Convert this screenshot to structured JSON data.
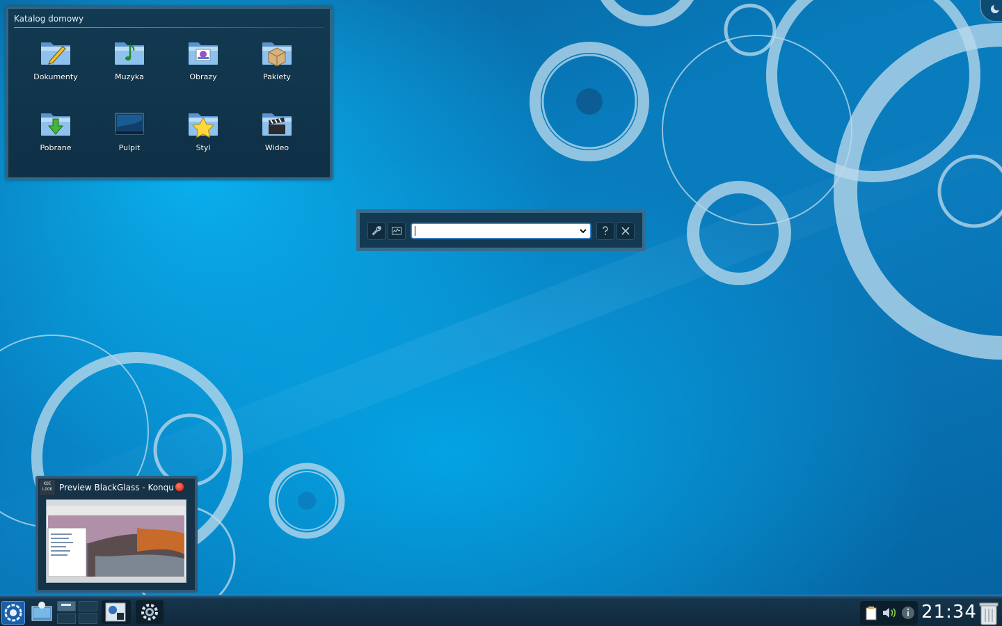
{
  "desktop": {
    "folder_view": {
      "title": "Katalog domowy",
      "items": [
        {
          "label": "Dokumenty",
          "icon": "documents-folder-icon"
        },
        {
          "label": "Muzyka",
          "icon": "music-folder-icon"
        },
        {
          "label": "Obrazy",
          "icon": "pictures-folder-icon"
        },
        {
          "label": "Pakiety",
          "icon": "packages-folder-icon"
        },
        {
          "label": "Pobrane",
          "icon": "downloads-folder-icon"
        },
        {
          "label": "Pulpit",
          "icon": "desktop-folder-icon"
        },
        {
          "label": "Styl",
          "icon": "style-folder-icon"
        },
        {
          "label": "Wideo",
          "icon": "video-folder-icon"
        }
      ]
    },
    "krunner": {
      "input_value": "",
      "settings_icon": "wrench-icon",
      "activity_icon": "task-manager-icon",
      "help_icon": "question-icon",
      "close_icon": "close-icon"
    },
    "task_preview": {
      "title": "Preview BlackGlass - Konqu",
      "logo_text": "KDE LOOK"
    }
  },
  "taskbar": {
    "launcher_icon": "kde-menu-icon",
    "items": [
      "desktop-switch-icon",
      "konqueror-task-icon",
      "system-settings-icon"
    ],
    "clock": "21:34",
    "tray_icons": [
      "clipboard-icon",
      "volume-icon",
      "info-icon"
    ],
    "trash_icon": "trash-icon"
  },
  "colors": {
    "wallpaper_dark": "#0a5e98",
    "wallpaper_light": "#0ab0ee",
    "panel": "#10293b",
    "widget_bg": "#123a52"
  }
}
